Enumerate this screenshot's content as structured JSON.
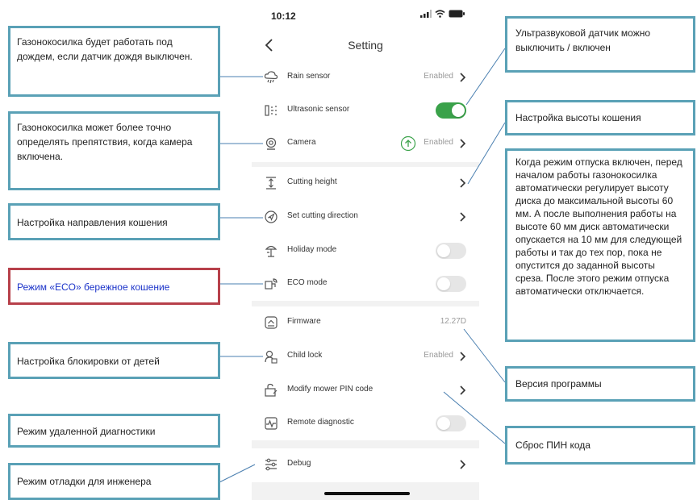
{
  "phone": {
    "time": "10:12",
    "title": "Setting",
    "accent_color": "#3aa24a",
    "groups": [
      {
        "rows": [
          {
            "icon": "rain-icon",
            "label": "Rain sensor",
            "value": "Enabled",
            "control": "chevron"
          },
          {
            "icon": "ultrasonic-icon",
            "label": "Ultrasonic sensor",
            "control": "toggle",
            "on": true
          },
          {
            "icon": "camera-icon",
            "label": "Camera",
            "value": "Enabled",
            "control": "chevron",
            "badge": "camera-upload-icon"
          }
        ]
      },
      {
        "rows": [
          {
            "icon": "height-icon",
            "label": "Cutting height",
            "control": "chevron"
          },
          {
            "icon": "direction-icon",
            "label": "Set cutting direction",
            "control": "chevron"
          },
          {
            "icon": "holiday-icon",
            "label": "Holiday mode",
            "control": "toggle",
            "on": false
          },
          {
            "icon": "eco-icon",
            "label": "ECO mode",
            "control": "toggle",
            "on": false
          }
        ]
      },
      {
        "rows": [
          {
            "icon": "firmware-icon",
            "label": "Firmware",
            "value": "12.27D",
            "control": "none"
          },
          {
            "icon": "lock-icon",
            "label": "Child lock",
            "value": "Enabled",
            "control": "chevron"
          },
          {
            "icon": "pin-icon",
            "label": "Modify mower PIN code",
            "control": "chevron"
          },
          {
            "icon": "diagnostic-icon",
            "label": "Remote diagnostic",
            "control": "toggle",
            "on": false
          }
        ]
      },
      {
        "rows": [
          {
            "icon": "debug-icon",
            "label": "Debug",
            "control": "chevron"
          }
        ]
      }
    ]
  },
  "annotations": {
    "rain": "Газонокосилка будет работать под дождем, если датчик дождя выключен.",
    "camera": "Газонокосилка может более точно определять препятствия, когда камера включена.",
    "direction": "Настройка направления кошения",
    "eco": "Режим «ECO» бережное кошение",
    "childlock": "Настройка блокировки от детей",
    "remote": "Режим удаленной диагностики",
    "debug": "Режим отладки для инженера",
    "ultrasonic": "Ультразвуковой датчик можно выключить / включен",
    "height": "Настройка высоты кошения",
    "holiday": "Когда режим отпуска включен, перед началом работы газонокосилка автоматически регулирует высоту диска до максимальной высоты 60 мм. А после выполнения работы на высоте 60 мм диск автоматически опускается на 10 мм для следующей работы и так до тех пор, пока не опустится до заданной высоты среза. После этого режим отпуска автоматически отключается.",
    "firmware": "Версия программы",
    "pin": "Сброс ПИН кода"
  }
}
